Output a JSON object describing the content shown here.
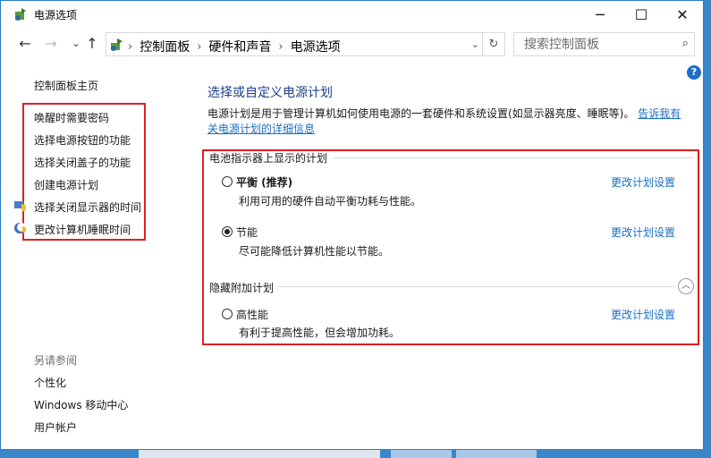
{
  "window": {
    "title": "电源选项",
    "minimize": "─",
    "maximize": "☐",
    "close": "✕"
  },
  "nav": {
    "back": "←",
    "forward": "→",
    "up": "↑",
    "breadcrumbs": [
      "控制面板",
      "硬件和声音",
      "电源选项"
    ],
    "dropdown": "⌄",
    "refresh": "↻"
  },
  "search": {
    "placeholder": "搜索控制面板",
    "icon": "search-icon"
  },
  "left": {
    "home": "控制面板主页",
    "tasks": [
      "唤醒时需要密码",
      "选择电源按钮的功能",
      "选择关闭盖子的功能",
      "创建电源计划",
      "选择关闭显示器的时间",
      "更改计算机睡眠时间"
    ],
    "see_also_title": "另请参阅",
    "see_also": [
      "个性化",
      "Windows 移动中心",
      "用户帐户"
    ]
  },
  "main": {
    "help": "?",
    "heading": "选择或自定义电源计划",
    "description": "电源计划是用于管理计算机如何使用电源的一套硬件和系统设置(如显示器亮度、睡眠等)。",
    "description_link": "告诉我有关电源计划的详细信息",
    "group_battery": "电池指示器上显示的计划",
    "group_hidden": "隐藏附加计划",
    "plans": [
      {
        "name": "平衡 (推荐)",
        "desc": "利用可用的硬件自动平衡功耗与性能。",
        "link": "更改计划设置",
        "selected": false
      },
      {
        "name": "节能",
        "desc": "尽可能降低计算机性能以节能。",
        "link": "更改计划设置",
        "selected": true
      },
      {
        "name": "高性能",
        "desc": "有利于提高性能，但会增加功耗。",
        "link": "更改计划设置",
        "selected": false
      }
    ]
  },
  "colors": {
    "accent": "#1a6ec2",
    "highlight_box": "#e02020",
    "border": "#2b7bd0"
  }
}
